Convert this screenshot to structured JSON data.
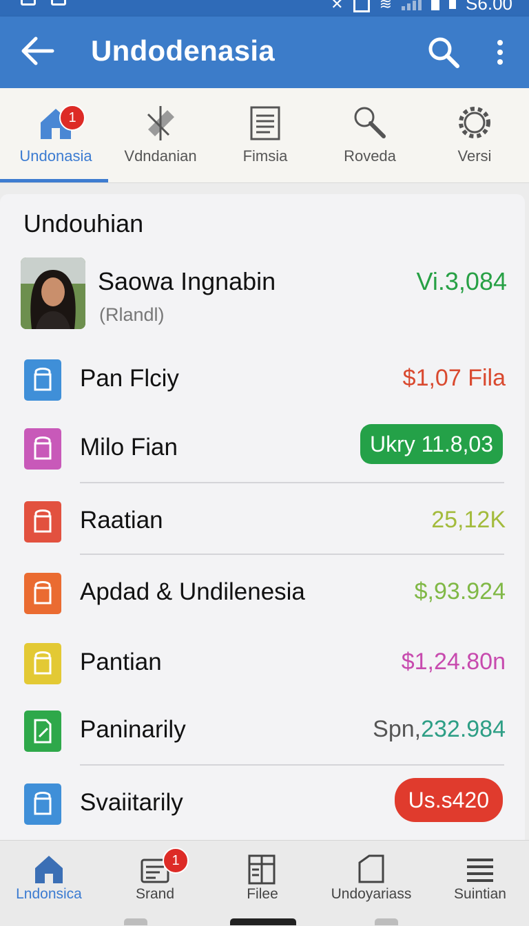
{
  "status_bar": {
    "time": "S6.00"
  },
  "app_bar": {
    "title": "Undodenasia"
  },
  "tabs": [
    {
      "label": "Undonasia",
      "icon": "home-icon",
      "badge": "1",
      "active": true
    },
    {
      "label": "Vdndanian",
      "icon": "tools-icon"
    },
    {
      "label": "Fimsia",
      "icon": "document-icon"
    },
    {
      "label": "Roveda",
      "icon": "magnifier-icon"
    },
    {
      "label": "Versi",
      "icon": "gear-icon"
    }
  ],
  "card": {
    "title": "Undouhian",
    "profile": {
      "name": "Saowa Ingnabin",
      "subtitle": "(Rlandl)",
      "value": "Vi.3,084"
    },
    "items": [
      {
        "label": "Pan Flciy",
        "value": "$1,07 Fila",
        "icon_color": "#3f8fd8",
        "value_color": "#d9492f",
        "style": "text",
        "icon": "bag-icon"
      },
      {
        "label": "Milo Fian",
        "value": "Ukry 11.8,03",
        "icon_color": "#c859b9",
        "value_color": "#24a148",
        "style": "pill-green",
        "icon": "bag-icon"
      },
      {
        "label": "Raatian",
        "value": "25,12K",
        "icon_color": "#e2513f",
        "value_color": "#a3bb3c",
        "style": "text",
        "icon": "bag-icon"
      },
      {
        "label": "Apdad & Undilenesia",
        "value": "$,93.924",
        "icon_color": "#ea6b31",
        "value_color": "#80b846",
        "style": "text",
        "icon": "bag-icon"
      },
      {
        "label": "Pantian",
        "value": "$1,24.80n",
        "icon_color": "#e3c934",
        "value_color": "#c74aae",
        "style": "text",
        "icon": "bag-icon"
      },
      {
        "label": "Paninarily",
        "value_prefix": "Spn,",
        "value": "232.984",
        "icon_color": "#2ea84a",
        "value_color": "#2d9e85",
        "style": "text",
        "icon": "edit-doc-icon"
      },
      {
        "label": "Svaiitarily",
        "value": "Us.s420",
        "icon_color": "#3f8fd8",
        "value_color": "#e03b2d",
        "style": "pill-red",
        "icon": "bag-icon"
      }
    ]
  },
  "bottom_nav": [
    {
      "label": "Lndonsica",
      "icon": "home-icon",
      "active": true
    },
    {
      "label": "Srand",
      "icon": "inbox-icon",
      "badge": "1"
    },
    {
      "label": "Filee",
      "icon": "files-icon"
    },
    {
      "label": "Undoyariass",
      "icon": "page-icon"
    },
    {
      "label": "Suintian",
      "icon": "menu-icon"
    }
  ],
  "colors": {
    "app_bar": "#3c7cc9",
    "accent": "#3b7bd1",
    "badge": "#dd2b26"
  }
}
